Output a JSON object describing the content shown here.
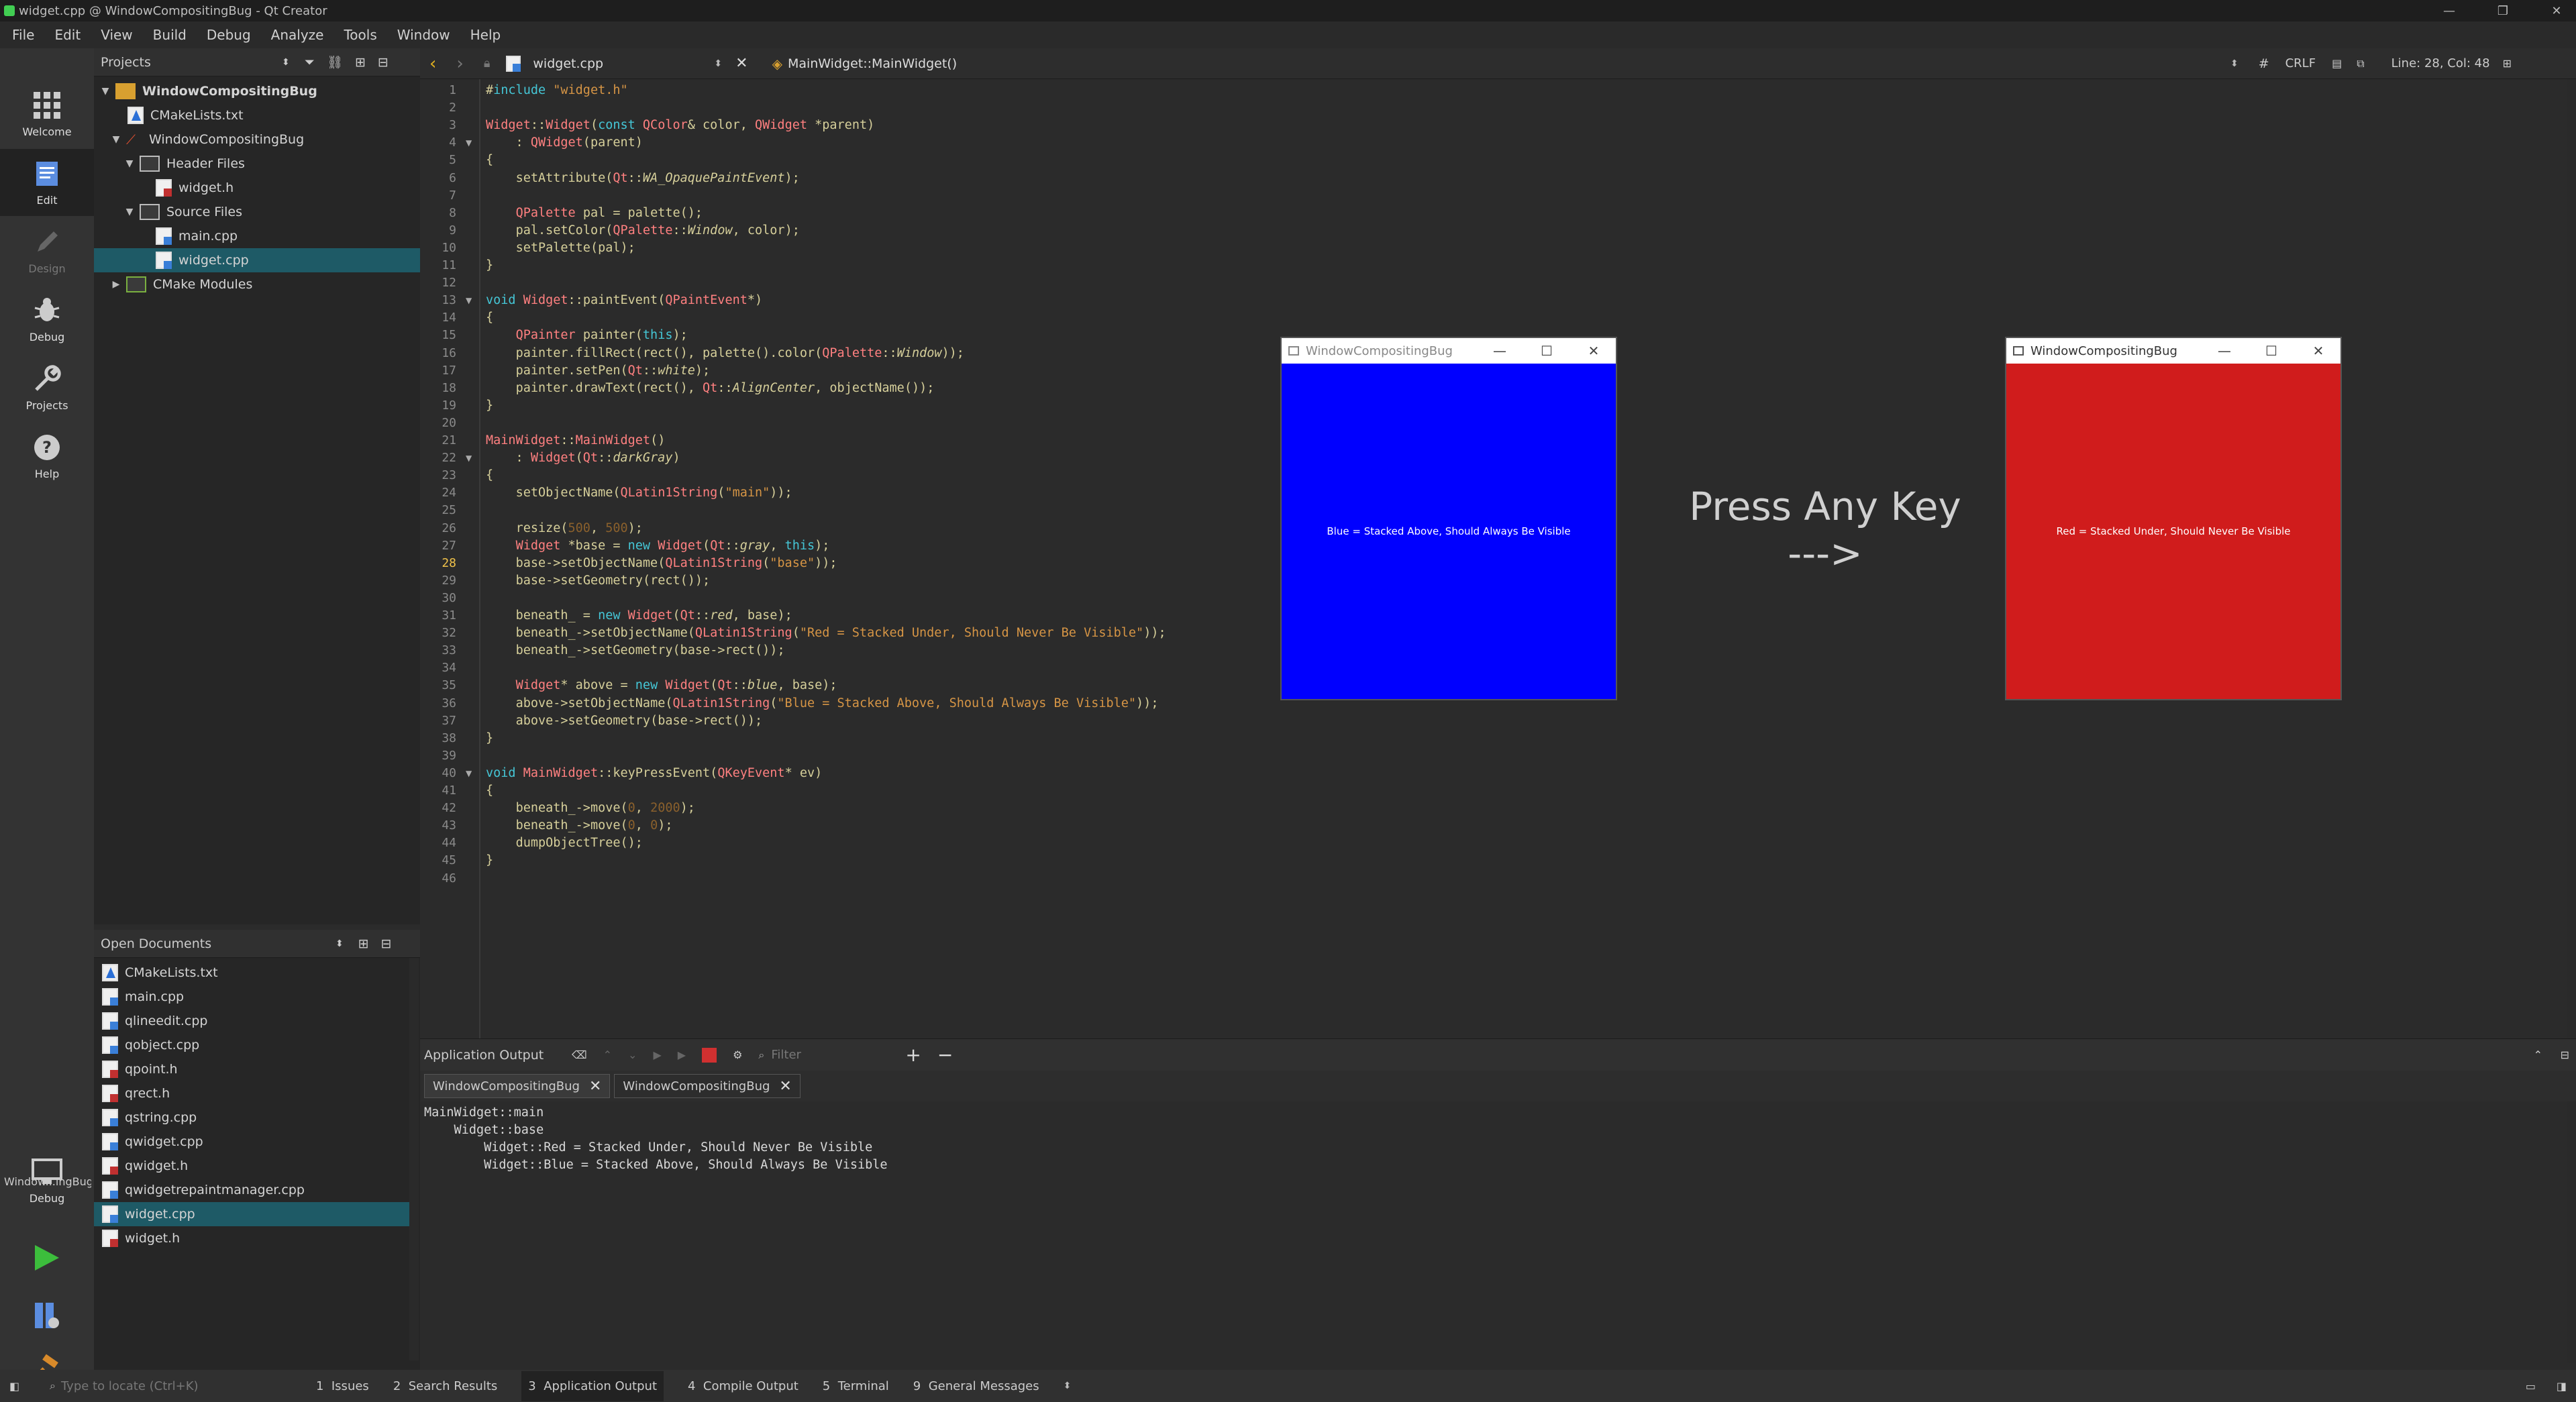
{
  "window": {
    "title": "widget.cpp @ WindowCompositingBug - Qt Creator"
  },
  "menu": [
    "File",
    "Edit",
    "View",
    "Build",
    "Debug",
    "Analyze",
    "Tools",
    "Window",
    "Help"
  ],
  "modes": [
    {
      "label": "Welcome",
      "icon": "grid-icon"
    },
    {
      "label": "Edit",
      "icon": "edit-icon"
    },
    {
      "label": "Design",
      "icon": "pencil-icon"
    },
    {
      "label": "Debug",
      "icon": "bug-icon"
    },
    {
      "label": "Projects",
      "icon": "wrench-icon"
    },
    {
      "label": "Help",
      "icon": "help-icon"
    }
  ],
  "run_target": {
    "name": "Window...ingBug",
    "mode": "Debug"
  },
  "projects": {
    "title": "Projects",
    "items": [
      {
        "label": "WindowCompositingBug",
        "depth": 0,
        "arrow": "▼",
        "icon": "project"
      },
      {
        "label": "CMakeLists.txt",
        "depth": 1,
        "arrow": "",
        "icon": "cmake"
      },
      {
        "label": "WindowCompositingBug",
        "depth": 1,
        "arrow": "▼",
        "icon": "target"
      },
      {
        "label": "Header Files",
        "depth": 2,
        "arrow": "▼",
        "icon": "folder"
      },
      {
        "label": "widget.h",
        "depth": 3,
        "arrow": "",
        "icon": "h"
      },
      {
        "label": "Source Files",
        "depth": 2,
        "arrow": "▼",
        "icon": "folder"
      },
      {
        "label": "main.cpp",
        "depth": 3,
        "arrow": "",
        "icon": "cpp"
      },
      {
        "label": "widget.cpp",
        "depth": 3,
        "arrow": "",
        "icon": "cpp",
        "selected": true
      },
      {
        "label": "CMake Modules",
        "depth": 1,
        "arrow": "▶",
        "icon": "folder"
      }
    ]
  },
  "open_documents": {
    "title": "Open Documents",
    "items": [
      "CMakeLists.txt",
      "main.cpp",
      "qlineedit.cpp",
      "qobject.cpp",
      "qpoint.h",
      "qrect.h",
      "qstring.cpp",
      "qwidget.cpp",
      "qwidget.h",
      "qwidgetrepaintmanager.cpp",
      "widget.cpp",
      "widget.h"
    ],
    "selected": "widget.cpp"
  },
  "editor": {
    "file": "widget.cpp",
    "symbol": "MainWidget::MainWidget()",
    "hash": "#",
    "eol": "CRLF",
    "position": "Line: 28, Col: 48",
    "current_line": 28,
    "lines": [
      "#include \"widget.h\"",
      "",
      "Widget::Widget(const QColor& color, QWidget *parent)",
      "    : QWidget(parent)",
      "{",
      "    setAttribute(Qt::WA_OpaquePaintEvent);",
      "",
      "    QPalette pal = palette();",
      "    pal.setColor(QPalette::Window, color);",
      "    setPalette(pal);",
      "}",
      "",
      "void Widget::paintEvent(QPaintEvent*)",
      "{",
      "    QPainter painter(this);",
      "    painter.fillRect(rect(), palette().color(QPalette::Window));",
      "    painter.setPen(Qt::white);",
      "    painter.drawText(rect(), Qt::AlignCenter, objectName());",
      "}",
      "",
      "MainWidget::MainWidget()",
      "    : Widget(Qt::darkGray)",
      "{",
      "    setObjectName(QLatin1String(\"main\"));",
      "",
      "    resize(500, 500);",
      "    Widget *base = new Widget(Qt::gray, this);",
      "    base->setObjectName(QLatin1String(\"base\"));",
      "    base->setGeometry(rect());",
      "",
      "    beneath_ = new Widget(Qt::red, base);",
      "    beneath_->setObjectName(QLatin1String(\"Red = Stacked Under, Should Never Be Visible\"));",
      "    beneath_->setGeometry(base->rect());",
      "",
      "    Widget* above = new Widget(Qt::blue, base);",
      "    above->setObjectName(QLatin1String(\"Blue = Stacked Above, Should Always Be Visible\"));",
      "    above->setGeometry(base->rect());",
      "}",
      "",
      "void MainWidget::keyPressEvent(QKeyEvent* ev)",
      "{",
      "    beneath_->move(0, 2000);",
      "    beneath_->move(0, 0);",
      "    dumpObjectTree();",
      "}",
      ""
    ]
  },
  "windows": [
    {
      "title": "WindowCompositingBug",
      "text": "Blue = Stacked Above, Should Always Be Visible",
      "color": "#0000ff"
    },
    {
      "title": "WindowCompositingBug",
      "text": "Red = Stacked Under, Should Never Be Visible",
      "color": "#d01c1c"
    }
  ],
  "annotation": {
    "line1": "Press Any Key",
    "line2": "--->"
  },
  "output": {
    "title": "Application Output",
    "filter_placeholder": "Filter",
    "tabs": [
      "WindowCompositingBug",
      "WindowCompositingBug"
    ],
    "lines": [
      "MainWidget::main",
      "    Widget::base",
      "        Widget::Red = Stacked Under, Should Never Be Visible",
      "        Widget::Blue = Stacked Above, Should Always Be Visible"
    ]
  },
  "locator": {
    "placeholder": "Type to locate (Ctrl+K)"
  },
  "status_tabs": [
    {
      "num": "1",
      "label": "Issues"
    },
    {
      "num": "2",
      "label": "Search Results"
    },
    {
      "num": "3",
      "label": "Application Output",
      "selected": true
    },
    {
      "num": "4",
      "label": "Compile Output"
    },
    {
      "num": "5",
      "label": "Terminal"
    },
    {
      "num": "9",
      "label": "General Messages"
    }
  ]
}
